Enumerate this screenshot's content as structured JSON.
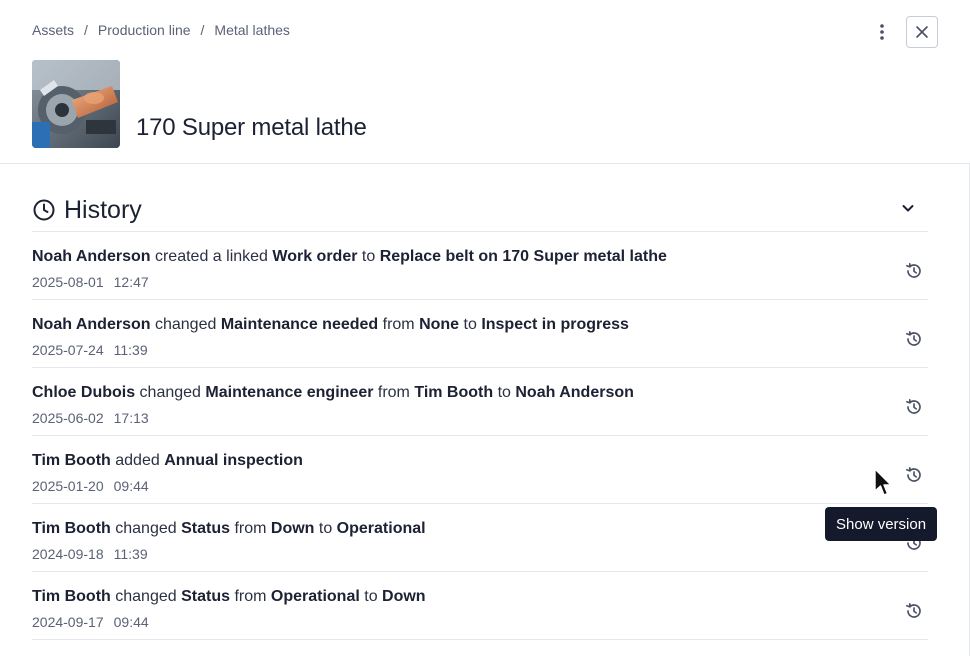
{
  "breadcrumb": {
    "items": [
      "Assets",
      "Production line",
      "Metal lathes"
    ],
    "separator": "/"
  },
  "header": {
    "title": "170 Super metal lathe",
    "more_icon": "more-vertical-icon",
    "close_icon": "close-icon",
    "thumbnail_alt": "metal lathe photo"
  },
  "history": {
    "title": "History",
    "icon": "clock-icon",
    "toggle_icon": "chevron-down-icon",
    "entries": [
      {
        "parts": [
          {
            "t": "Noah Anderson",
            "b": true
          },
          {
            "t": " created a linked ",
            "b": false
          },
          {
            "t": "Work order",
            "b": true
          },
          {
            "t": " to ",
            "b": false
          },
          {
            "t": "Replace belt on 170 Super metal lathe",
            "b": true
          }
        ],
        "date": "2025-08-01",
        "time": "12:47"
      },
      {
        "parts": [
          {
            "t": "Noah Anderson",
            "b": true
          },
          {
            "t": " changed ",
            "b": false
          },
          {
            "t": "Maintenance needed",
            "b": true
          },
          {
            "t": " from ",
            "b": false
          },
          {
            "t": "None",
            "b": true
          },
          {
            "t": " to ",
            "b": false
          },
          {
            "t": "Inspect in progress",
            "b": true
          }
        ],
        "date": "2025-07-24",
        "time": "11:39"
      },
      {
        "parts": [
          {
            "t": "Chloe Dubois",
            "b": true
          },
          {
            "t": " changed ",
            "b": false
          },
          {
            "t": "Maintenance engineer",
            "b": true
          },
          {
            "t": " from ",
            "b": false
          },
          {
            "t": "Tim Booth",
            "b": true
          },
          {
            "t": " to ",
            "b": false
          },
          {
            "t": "Noah Anderson",
            "b": true
          }
        ],
        "date": "2025-06-02",
        "time": "17:13"
      },
      {
        "parts": [
          {
            "t": "Tim Booth",
            "b": true
          },
          {
            "t": " added ",
            "b": false
          },
          {
            "t": "Annual inspection",
            "b": true
          }
        ],
        "date": "2025-01-20",
        "time": "09:44"
      },
      {
        "parts": [
          {
            "t": "Tim Booth",
            "b": true
          },
          {
            "t": " changed ",
            "b": false
          },
          {
            "t": "Status",
            "b": true
          },
          {
            "t": " from ",
            "b": false
          },
          {
            "t": "Down",
            "b": true
          },
          {
            "t": " to ",
            "b": false
          },
          {
            "t": "Operational",
            "b": true
          }
        ],
        "date": "2024-09-18",
        "time": "11:39"
      },
      {
        "parts": [
          {
            "t": "Tim Booth",
            "b": true
          },
          {
            "t": " changed ",
            "b": false
          },
          {
            "t": "Status",
            "b": true
          },
          {
            "t": " from ",
            "b": false
          },
          {
            "t": "Operational",
            "b": true
          },
          {
            "t": " to ",
            "b": false
          },
          {
            "t": "Down",
            "b": true
          }
        ],
        "date": "2024-09-17",
        "time": "09:44"
      }
    ],
    "restore_icon": "restore-version-icon"
  },
  "tooltip": {
    "text": "Show version"
  },
  "colors": {
    "text": "#1c2133",
    "muted": "#5b6275",
    "divider": "#e6e8ee",
    "tooltip_bg": "#141a2b"
  }
}
